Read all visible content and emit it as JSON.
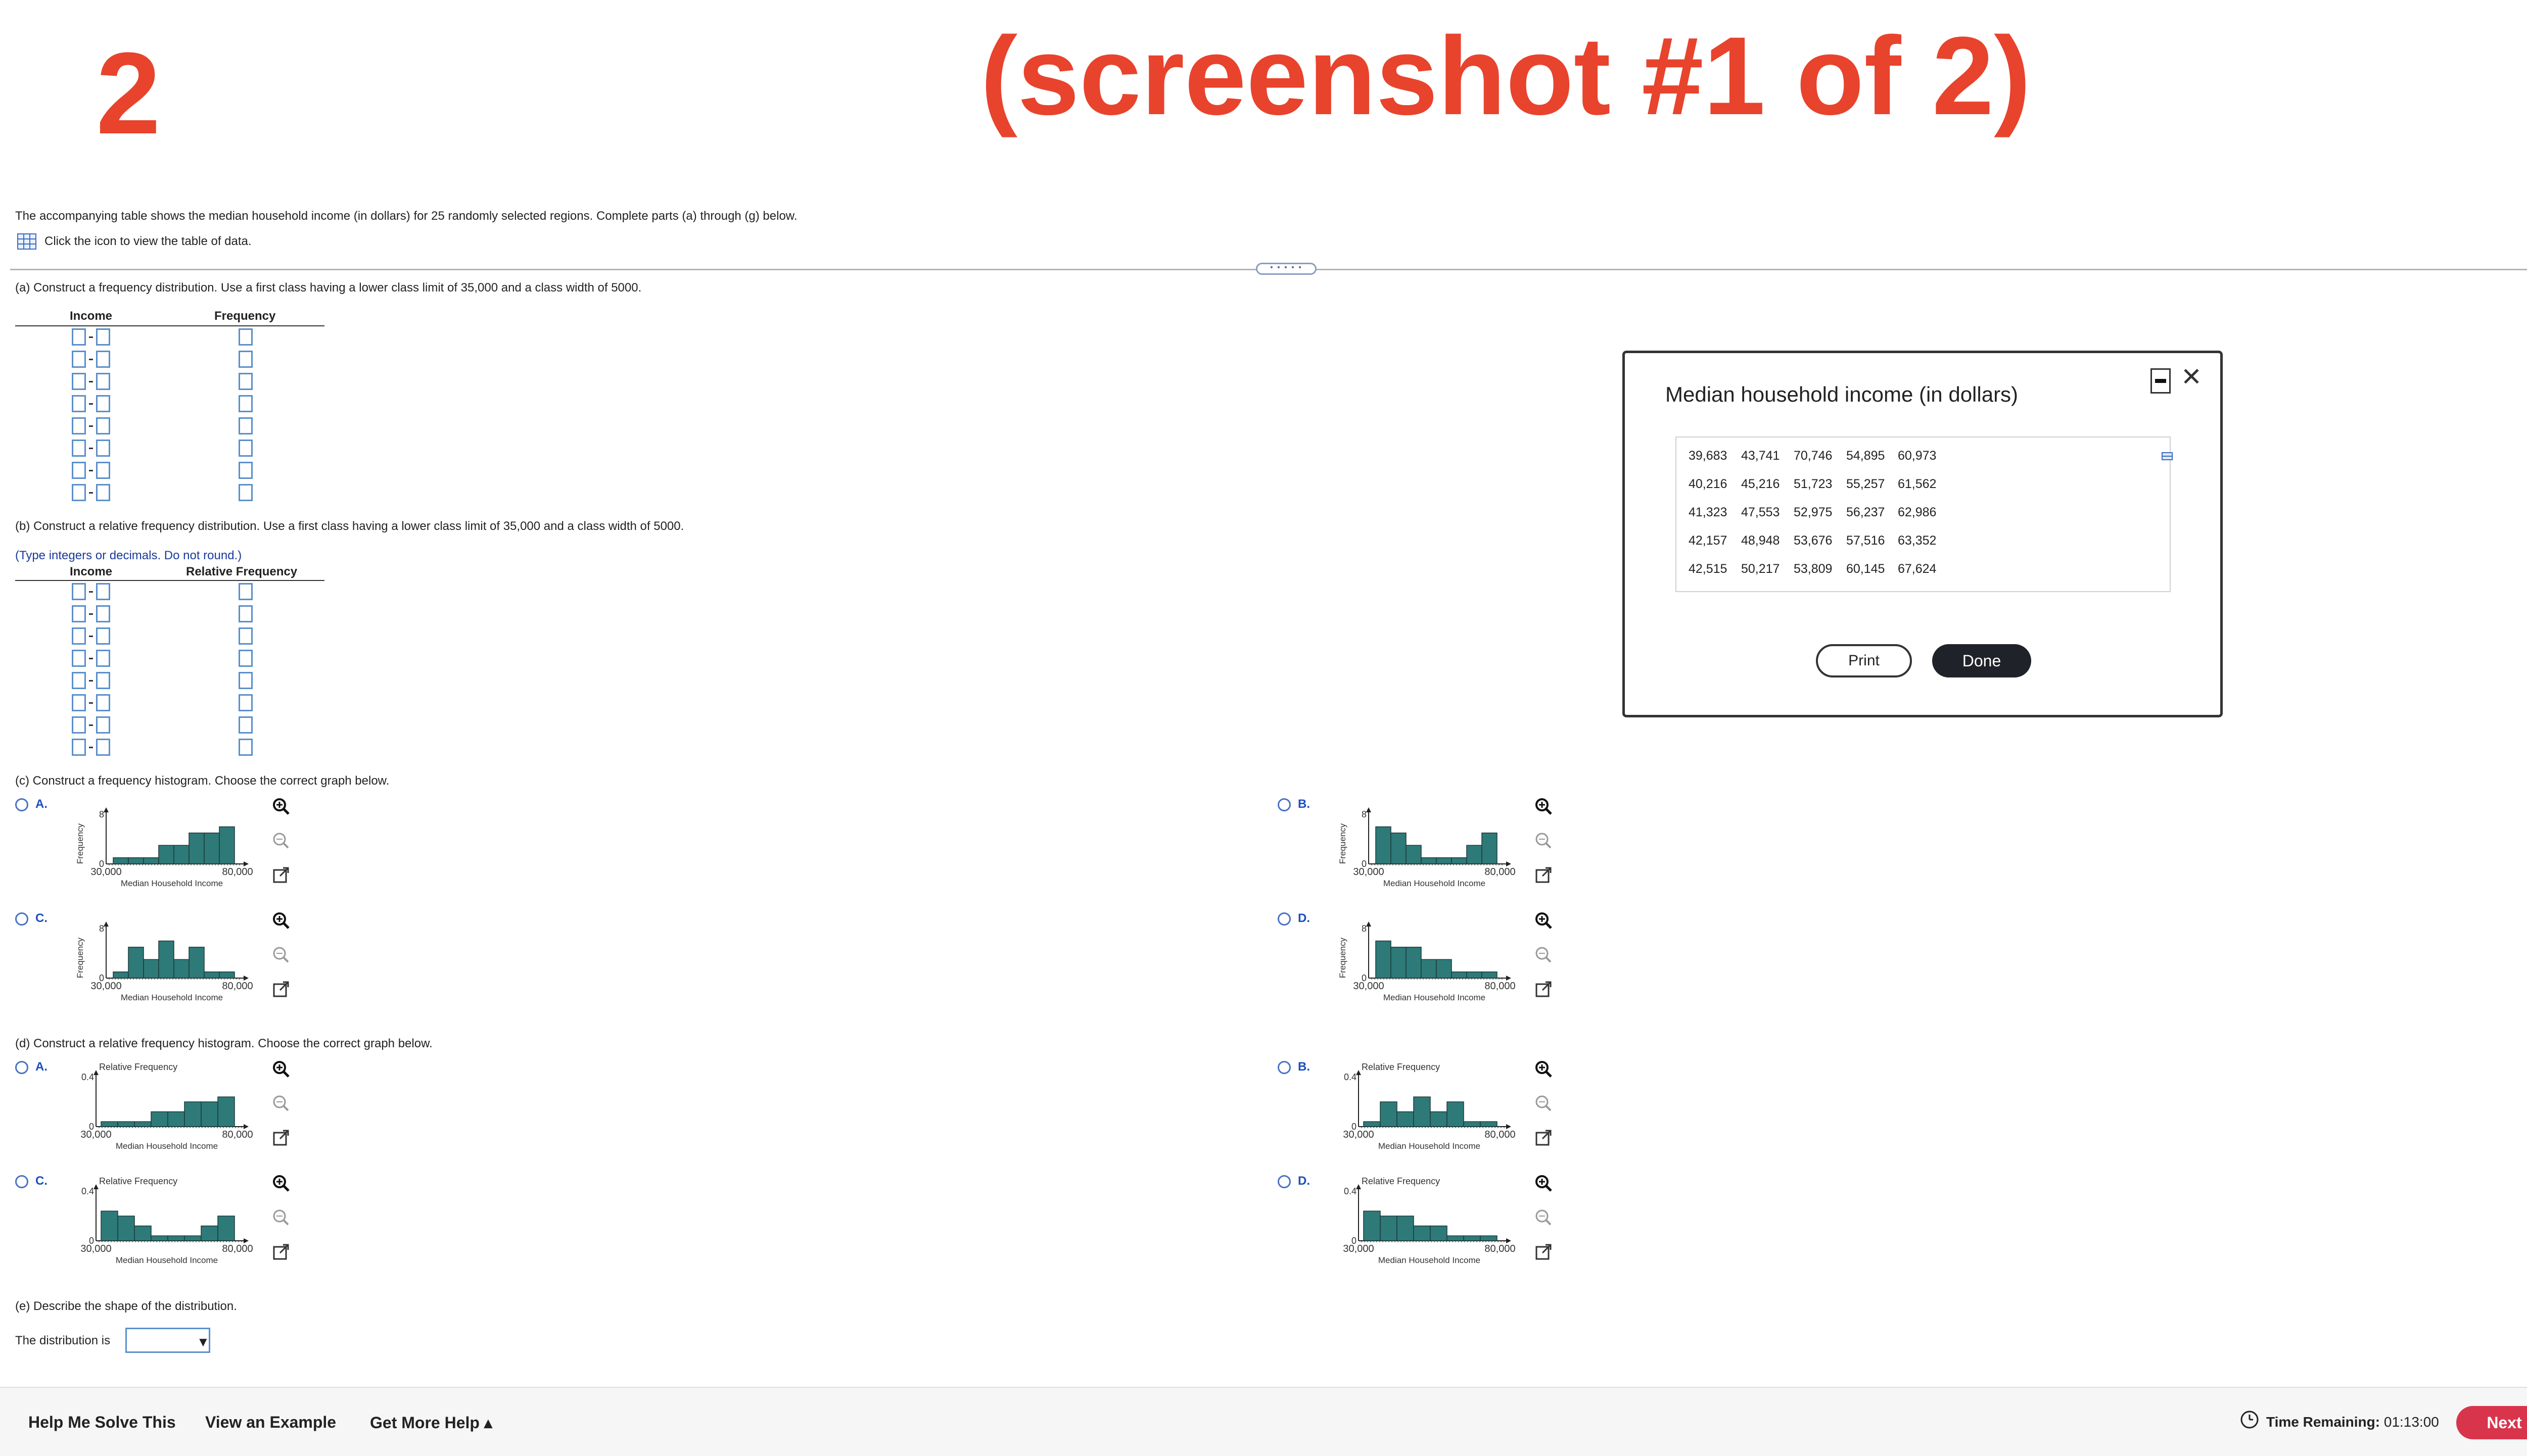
{
  "overlay": {
    "number": "2",
    "title": "(screenshot #1 of 2)"
  },
  "question": {
    "intro": "The accompanying table shows the median household income (in dollars) for 25 randomly selected regions. Complete parts (a) through (g) below.",
    "data_link": "Click the icon to view the table of data."
  },
  "part_a": {
    "prompt": "(a) Construct a frequency distribution. Use a first class having a lower class limit of 35,000 and a class width of 5000.",
    "col1": "Income",
    "col2": "Frequency"
  },
  "part_b": {
    "prompt": "(b) Construct a relative frequency distribution. Use a first class having a lower class limit of 35,000 and a class width of 5000.",
    "hint": "(Type integers or decimals. Do not round.)",
    "col1": "Income",
    "col2": "Relative Frequency"
  },
  "part_c": {
    "prompt": "(c) Construct a frequency histogram. Choose the correct graph below.",
    "options": [
      {
        "label": "A.",
        "ylabel": "Frequency",
        "ytick": "8",
        "x_left": "30,000",
        "x_right": "80,000",
        "xlabel": "Median Household Income",
        "bars": [
          1,
          1,
          1,
          3,
          3,
          5,
          5,
          6
        ]
      },
      {
        "label": "B.",
        "ylabel": "Frequency",
        "ytick": "8",
        "x_left": "30,000",
        "x_right": "80,000",
        "xlabel": "Median Household Income",
        "bars": [
          6,
          5,
          3,
          1,
          1,
          1,
          3,
          5
        ]
      },
      {
        "label": "C.",
        "ylabel": "Frequency",
        "ytick": "8",
        "x_left": "30,000",
        "x_right": "80,000",
        "xlabel": "Median Household Income",
        "bars": [
          1,
          5,
          3,
          6,
          3,
          5,
          1,
          1
        ]
      },
      {
        "label": "D.",
        "ylabel": "Frequency",
        "ytick": "8",
        "x_left": "30,000",
        "x_right": "80,000",
        "xlabel": "Median Household Income",
        "bars": [
          6,
          5,
          5,
          3,
          3,
          1,
          1,
          1
        ]
      }
    ]
  },
  "part_d": {
    "prompt": "(d) Construct a relative frequency histogram. Choose the correct graph below.",
    "options": [
      {
        "label": "A.",
        "ylabel": "Relative Frequency",
        "ytick": "0.4",
        "x_left": "30,000",
        "x_right": "80,000",
        "xlabel": "Median Household Income",
        "bars": [
          0.04,
          0.04,
          0.04,
          0.12,
          0.12,
          0.2,
          0.2,
          0.24
        ]
      },
      {
        "label": "B.",
        "ylabel": "Relative Frequency",
        "ytick": "0.4",
        "x_left": "30,000",
        "x_right": "80,000",
        "xlabel": "Median Household Income",
        "bars": [
          0.04,
          0.2,
          0.12,
          0.24,
          0.12,
          0.2,
          0.04,
          0.04
        ]
      },
      {
        "label": "C.",
        "ylabel": "Relative Frequency",
        "ytick": "0.4",
        "x_left": "30,000",
        "x_right": "80,000",
        "xlabel": "Median Household Income",
        "bars": [
          0.24,
          0.2,
          0.12,
          0.04,
          0.04,
          0.04,
          0.12,
          0.2
        ]
      },
      {
        "label": "D.",
        "ylabel": "Relative Frequency",
        "ytick": "0.4",
        "x_left": "30,000",
        "x_right": "80,000",
        "xlabel": "Median Household Income",
        "bars": [
          0.24,
          0.2,
          0.2,
          0.12,
          0.12,
          0.04,
          0.04,
          0.04
        ]
      }
    ]
  },
  "part_e": {
    "prompt": "(e) Describe the shape of the distribution.",
    "lead": "The distribution is"
  },
  "modal": {
    "title": "Median household income (in dollars)",
    "rows": [
      [
        "39,683",
        "43,741",
        "70,746",
        "54,895",
        "60,973"
      ],
      [
        "40,216",
        "45,216",
        "51,723",
        "55,257",
        "61,562"
      ],
      [
        "41,323",
        "47,553",
        "52,975",
        "56,237",
        "62,986"
      ],
      [
        "42,157",
        "48,948",
        "53,676",
        "57,516",
        "63,352"
      ],
      [
        "42,515",
        "50,217",
        "53,809",
        "60,145",
        "67,624"
      ]
    ],
    "print_label": "Print",
    "done_label": "Done"
  },
  "footer": {
    "help": "Help Me Solve This",
    "example": "View an Example",
    "more": "Get More Help ▴",
    "timer_label": "Time Remaining:",
    "timer_value": "01:13:00",
    "next_label": "Next"
  },
  "colors": {
    "accent_red": "#e8432d",
    "bar_fill": "#2e7a78",
    "next_btn": "#d8354d",
    "link_blue": "#1a4fbf"
  }
}
